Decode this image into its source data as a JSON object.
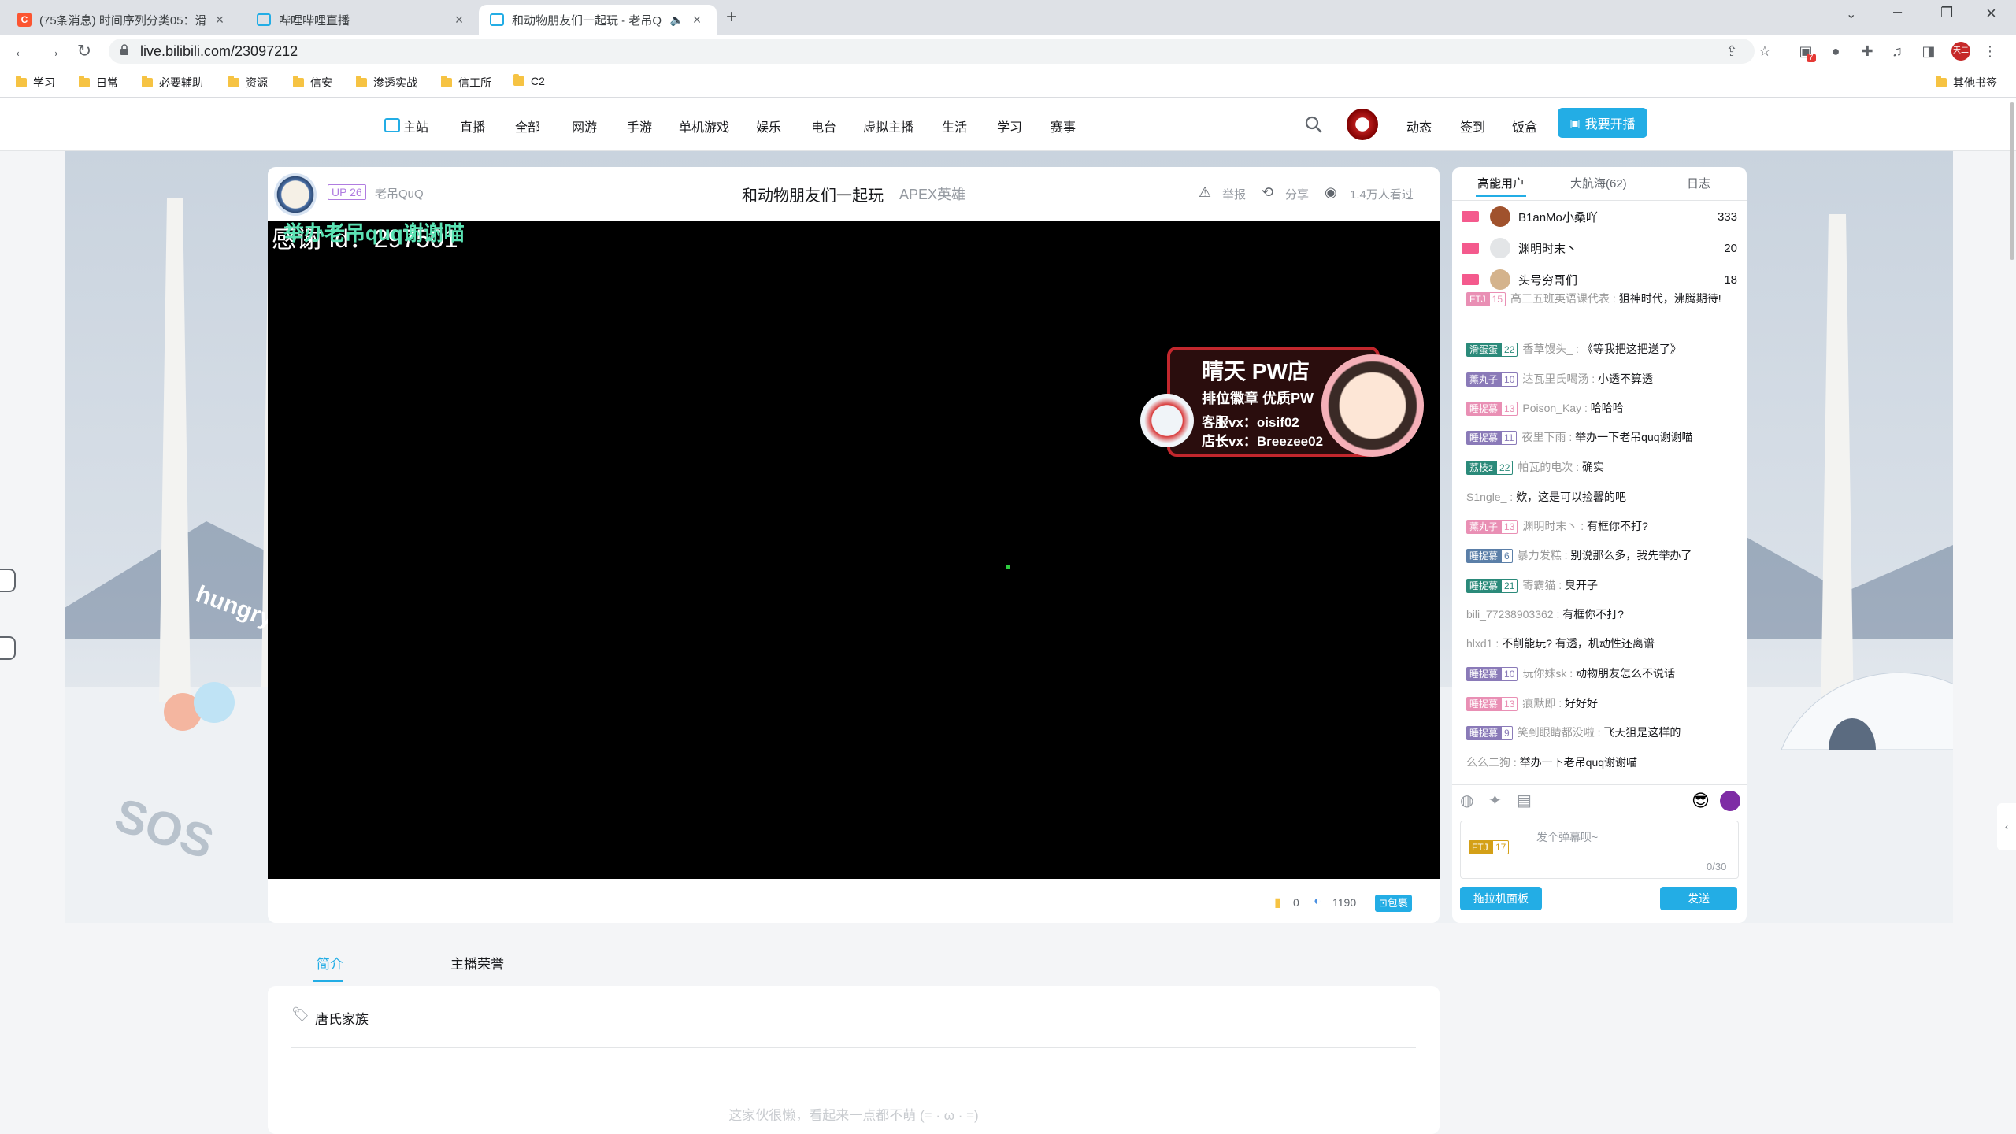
{
  "browser": {
    "tabs": [
      {
        "title": "(75条消息) 时间序列分类05：滑",
        "favicon_color": "#fc5531",
        "favicon_letter": "C"
      },
      {
        "title": "哔哩哔哩直播",
        "favicon_color": "#23ade5",
        "favicon_letter": ""
      },
      {
        "title": "和动物朋友们一起玩 - 老吊Q",
        "favicon_color": "#23ade5",
        "favicon_letter": ""
      }
    ],
    "new_tab": "+",
    "url": "live.bilibili.com/23097212",
    "extension_badge": "7",
    "profile_text": "天二",
    "bookmarks": [
      "学习",
      "日常",
      "必要辅助",
      "资源",
      "信安",
      "渗透实战",
      "信工所",
      "C2"
    ],
    "other_bookmarks": "其他书签"
  },
  "header": {
    "nav": [
      "主站",
      "直播",
      "全部",
      "网游",
      "手游",
      "单机游戏",
      "娱乐",
      "电台",
      "虚拟主播",
      "生活",
      "学习",
      "赛事"
    ],
    "right_links": [
      "动态",
      "签到",
      "饭盒"
    ],
    "start_live": "我要开播"
  },
  "room": {
    "up_level": "UP 26",
    "streamer": "老吊QuQ",
    "title": "和动物朋友们一起玩",
    "category": "APEX英雄",
    "report": "举报",
    "share": "分享",
    "viewers": "1.4万人看过"
  },
  "video": {
    "overlay_text": "感谢 id：297501",
    "green_danmaku": "举办老吊quq谢谢喵",
    "ad": {
      "title": "晴天 PW店",
      "subtitle": "排位徽章 优质PW",
      "line1": "客服vx：oisif02",
      "line2": "店长vx：Breezee02"
    },
    "side_text": "hungry",
    "sos_text": "SOS"
  },
  "player_bar": {
    "battery": "0",
    "silver": "1190",
    "pack": "包裹"
  },
  "chat": {
    "tabs": [
      "高能用户",
      "大航海(62)",
      "日志"
    ],
    "ranks": [
      {
        "name": "B1anMo小桑吖",
        "score": "333",
        "badge_color": "#f45a8d"
      },
      {
        "name": "渊明时末丶",
        "score": "20",
        "badge_color": "#f45a8d"
      },
      {
        "name": "头号穷哥们",
        "score": "18",
        "badge_color": "#f45a8d"
      }
    ],
    "messages": [
      {
        "medal": "FTJ",
        "lv": "15",
        "medal_color": "#e98fb4",
        "name": "高三五班英语课代表",
        "text": "狙神时代，沸腾期待!"
      },
      {
        "medal": "滑蛋蛋",
        "lv": "22",
        "medal_color": "#2b8a7a",
        "name": "香草馒头_",
        "text": "《等我把这把送了》"
      },
      {
        "medal": "薰丸子",
        "lv": "10",
        "medal_color": "#8a7ab8",
        "name": "达瓦里氏喝汤",
        "text": "小透不算透"
      },
      {
        "medal": "睡捉慕",
        "lv": "13",
        "medal_color": "#e98fb4",
        "name": "Poison_Kay",
        "text": "哈哈哈"
      },
      {
        "medal": "睡捉慕",
        "lv": "11",
        "medal_color": "#8a7ab8",
        "name": "夜里下雨",
        "text": "举办一下老吊quq谢谢喵"
      },
      {
        "medal": "荔枝z",
        "lv": "22",
        "medal_color": "#2b8a7a",
        "name": "帕瓦的电次",
        "text": "确实"
      },
      {
        "medal": "",
        "lv": "",
        "medal_color": "",
        "name": "S1ngle_",
        "text": "欸，这是可以捡馨的吧"
      },
      {
        "medal": "薰丸子",
        "lv": "13",
        "medal_color": "#e98fb4",
        "name": "渊明时末丶",
        "text": "有框你不打?"
      },
      {
        "medal": "睡捉慕",
        "lv": "6",
        "medal_color": "#5b7fa8",
        "name": "暴力发糕",
        "text": "别说那么多，我先举办了"
      },
      {
        "medal": "睡捉慕",
        "lv": "21",
        "medal_color": "#2b8a7a",
        "name": "寄霸猫",
        "text": "臭开子"
      },
      {
        "medal": "",
        "lv": "",
        "medal_color": "",
        "name": "bili_77238903362",
        "text": "有框你不打?"
      },
      {
        "medal": "",
        "lv": "",
        "medal_color": "",
        "name": "hlxd1",
        "text": "不削能玩? 有透，机动性还离谱"
      },
      {
        "medal": "睡捉慕",
        "lv": "10",
        "medal_color": "#8a7ab8",
        "name": "玩你妹sk",
        "text": "动物朋友怎么不说话"
      },
      {
        "medal": "睡捉慕",
        "lv": "13",
        "medal_color": "#e98fb4",
        "name": "痕默即",
        "text": "好好好"
      },
      {
        "medal": "睡捉慕",
        "lv": "9",
        "medal_color": "#8a7ab8",
        "name": "笑到眼睛都没啦",
        "text": "飞天狙是这样的"
      },
      {
        "medal": "",
        "lv": "",
        "medal_color": "",
        "name": "么么二狗",
        "text": "举办一下老吊quq谢谢喵"
      }
    ],
    "input_medal": "FTJ",
    "input_lv": "17",
    "input_placeholder": "发个弹幕呗~",
    "char_count": "0/30",
    "panel_button": "拖拉机面板",
    "send_button": "发送"
  },
  "below": {
    "tabs": [
      "简介",
      "主播荣誉"
    ],
    "tag": "唐氏家族",
    "empty_text": "这家伙很懒，看起来一点都不萌 (= · ω · =)"
  }
}
